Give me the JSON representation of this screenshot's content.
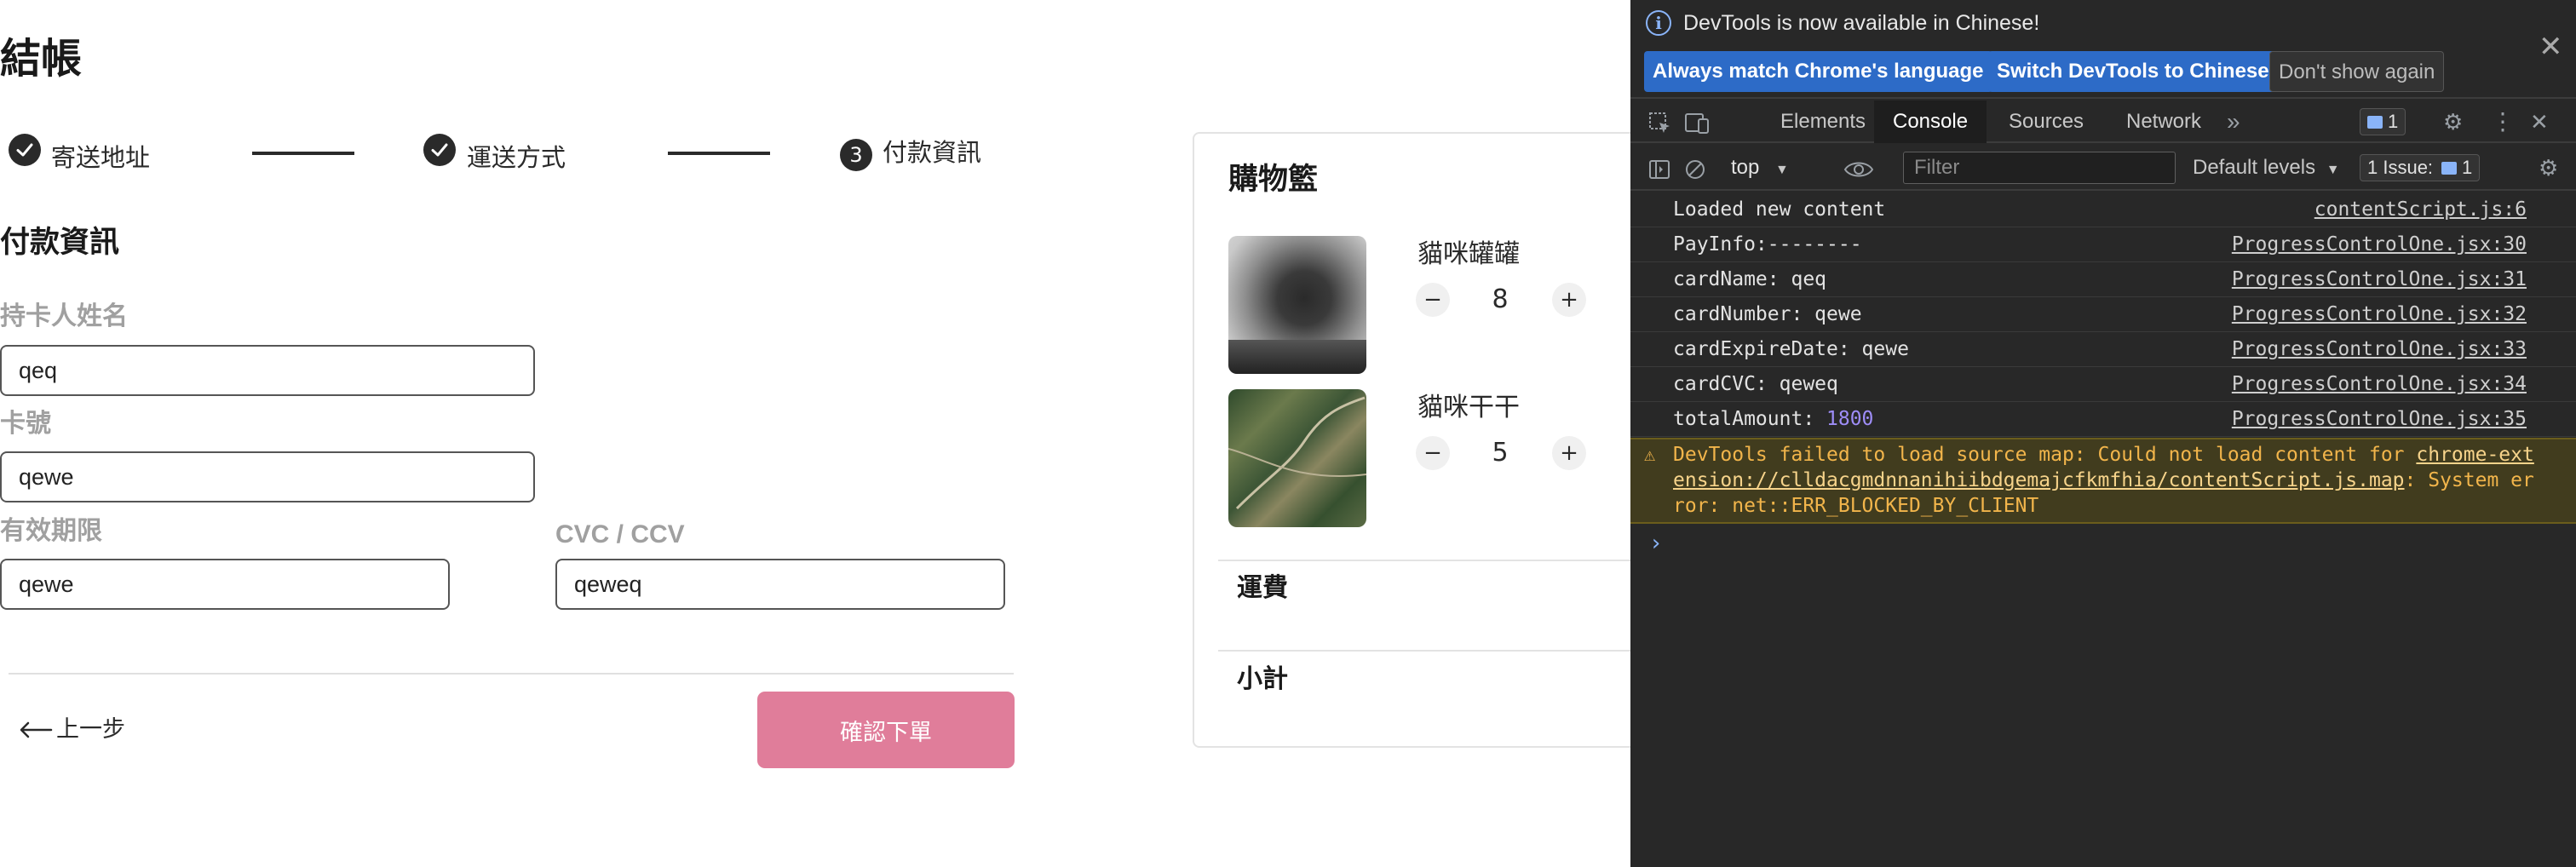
{
  "checkout": {
    "page_title": "結帳",
    "steps": [
      {
        "label": "寄送地址",
        "state": "done"
      },
      {
        "label": "運送方式",
        "state": "done"
      },
      {
        "label": "付款資訊",
        "state": "current",
        "number": "3"
      }
    ],
    "section_title": "付款資訊",
    "fields": {
      "card_name": {
        "label": "持卡人姓名",
        "value": "qeq"
      },
      "card_number": {
        "label": "卡號",
        "value": "qewe"
      },
      "expire": {
        "label": "有效期限",
        "value": "qewe"
      },
      "cvc": {
        "label": "CVC / CCV",
        "value": "qeweq"
      }
    },
    "back_label": "上一步",
    "confirm_label": "確認下單",
    "accent_color": "#e07d9a"
  },
  "cart": {
    "title": "購物籃",
    "items": [
      {
        "name": "貓咪罐罐",
        "quantity": "8"
      },
      {
        "name": "貓咪干干",
        "quantity": "5"
      }
    ],
    "minus": "−",
    "plus": "+",
    "shipping_label": "運費",
    "subtotal_label": "小計"
  },
  "devtools": {
    "notice": "DevTools is now available in Chinese!",
    "notice_buttons": [
      "Always match Chrome's language",
      "Switch DevTools to Chinese",
      "Don't show again"
    ],
    "tabs": [
      "Elements",
      "Console",
      "Sources",
      "Network"
    ],
    "active_tab": "Console",
    "message_count": "1",
    "context": "top",
    "filter_placeholder": "Filter",
    "levels": "Default levels",
    "issues_label": "1 Issue:",
    "issues_count": "1",
    "logs": [
      {
        "message": "Loaded new content",
        "source": "contentScript.js:6"
      },
      {
        "message": "PayInfo:--------",
        "source": "ProgressControlOne.jsx:30"
      },
      {
        "message": "cardName: qeq",
        "source": "ProgressControlOne.jsx:31"
      },
      {
        "message": "cardNumber: qewe",
        "source": "ProgressControlOne.jsx:32"
      },
      {
        "message": "cardExpireDate: qewe",
        "source": "ProgressControlOne.jsx:33"
      },
      {
        "message": "cardCVC: qeweq",
        "source": "ProgressControlOne.jsx:34"
      },
      {
        "message": "totalAmount: ",
        "value": "1800",
        "source": "ProgressControlOne.jsx:35"
      }
    ],
    "warning": {
      "prefix": "DevTools failed to load source map: Could not load content for ",
      "link": "chrome-extension://clldacgmdnnanihiibdgemajcfkmfhia/contentScript.js.map",
      "suffix": ": System error: net::ERR_BLOCKED_BY_CLIENT"
    },
    "prompt": "›"
  }
}
